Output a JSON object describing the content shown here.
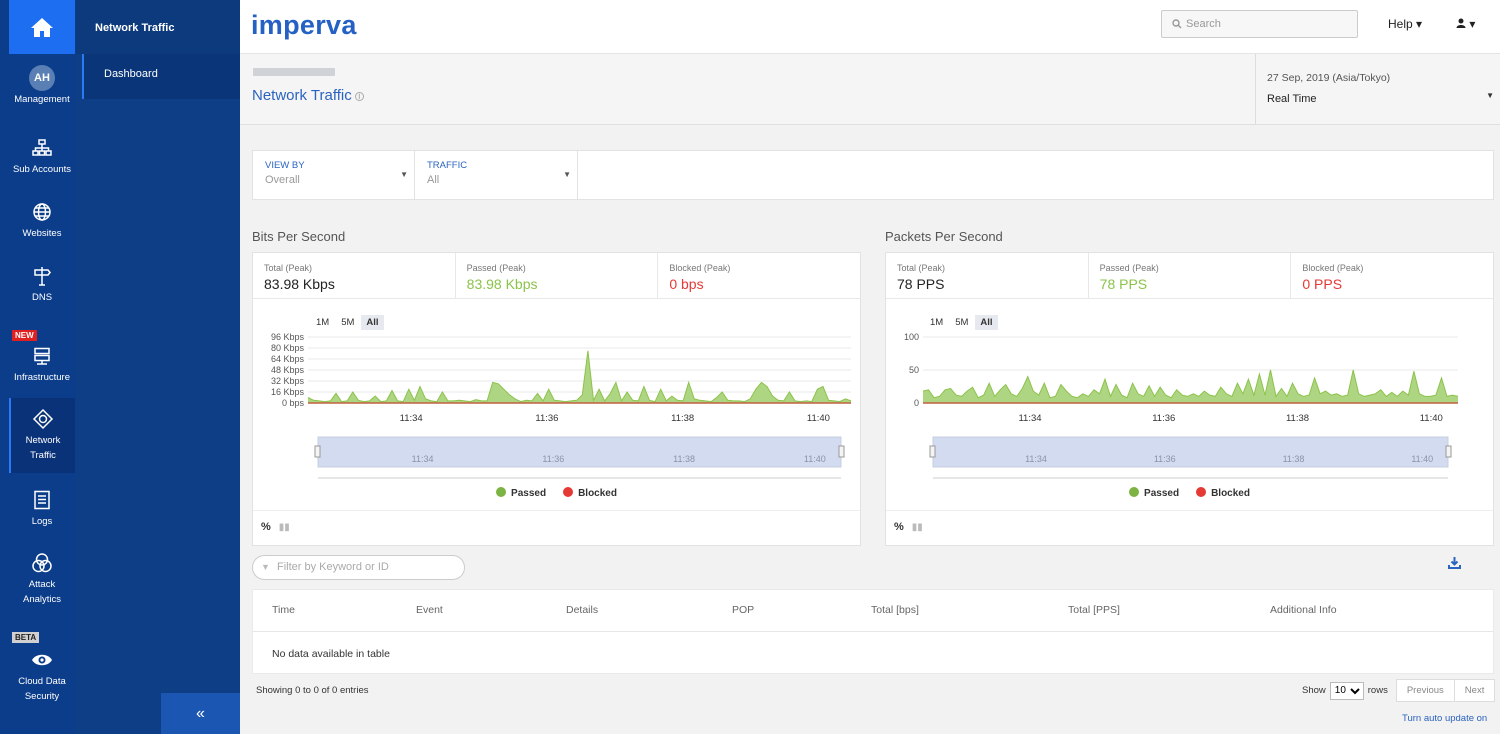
{
  "colors": {
    "brand": "#2561c5",
    "nav_bg": "#0c3d8a",
    "passed": "#8bc34a",
    "blocked": "#e53935",
    "area_fill": "#aed582",
    "navigator": "#d2dbef"
  },
  "nav": {
    "avatar_initials": "AH",
    "items": [
      {
        "label": "Management",
        "icon": "avatar"
      },
      {
        "label": "Sub Accounts",
        "icon": "sitemap-icon"
      },
      {
        "label": "Websites",
        "icon": "globe-icon"
      },
      {
        "label": "DNS",
        "icon": "signpost-icon"
      },
      {
        "label": "Infrastructure",
        "icon": "server-icon",
        "tag": "NEW"
      },
      {
        "label": "Network Traffic",
        "icon": "crosshair-icon",
        "active": true
      },
      {
        "label": "Logs",
        "icon": "logs-icon"
      },
      {
        "label": "Attack Analytics",
        "icon": "analytics-icon"
      },
      {
        "label": "Cloud Data Security",
        "icon": "eye-icon",
        "tag": "BETA"
      }
    ]
  },
  "subnav": {
    "title": "Network Traffic",
    "items": [
      "Dashboard"
    ],
    "collapse": "«"
  },
  "header": {
    "logo": "imperva",
    "search_placeholder": "Search",
    "help": "Help ▾",
    "user": "▾"
  },
  "page": {
    "title": "Network Traffic",
    "date": "27 Sep, 2019 (Asia/Tokyo)",
    "mode": "Real Time"
  },
  "filters": [
    {
      "label": "VIEW BY",
      "value": "Overall"
    },
    {
      "label": "TRAFFIC",
      "value": "All"
    }
  ],
  "bps": {
    "title": "Bits Per Second",
    "stats": [
      {
        "label": "Total (Peak)",
        "value": "83.98 Kbps"
      },
      {
        "label": "Passed (Peak)",
        "value": "83.98 Kbps"
      },
      {
        "label": "Blocked (Peak)",
        "value": "0 bps"
      }
    ]
  },
  "pps": {
    "title": "Packets Per Second",
    "stats": [
      {
        "label": "Total (Peak)",
        "value": "78 PPS"
      },
      {
        "label": "Passed (Peak)",
        "value": "78 PPS"
      },
      {
        "label": "Blocked (Peak)",
        "value": "0 PPS"
      }
    ]
  },
  "zoom": [
    "1M",
    "5M",
    "All"
  ],
  "legend": [
    "Passed",
    "Blocked"
  ],
  "chart_foot": "%",
  "chart_data": [
    {
      "type": "area",
      "title": "Bits Per Second",
      "yticks": [
        "96 Kbps",
        "80 Kbps",
        "64 Kbps",
        "48 Kbps",
        "32 Kbps",
        "16 Kbps",
        "0 bps"
      ],
      "ylim": [
        0,
        96
      ],
      "xticks": [
        "11:34",
        "11:36",
        "11:38",
        "11:40"
      ],
      "series": [
        {
          "name": "Passed",
          "values": [
            8,
            4,
            3,
            2,
            3,
            14,
            2,
            3,
            16,
            4,
            2,
            3,
            10,
            2,
            3,
            18,
            3,
            2,
            20,
            4,
            24,
            6,
            3,
            2,
            16,
            3,
            3,
            4,
            3,
            2,
            5,
            3,
            3,
            30,
            28,
            20,
            12,
            6,
            2,
            4,
            3,
            14,
            3,
            20,
            4,
            3,
            2,
            3,
            4,
            12,
            76,
            4,
            20,
            3,
            14,
            30,
            3,
            16,
            4,
            3,
            24,
            4,
            2,
            20,
            3,
            10,
            4,
            3,
            30,
            6,
            4,
            3,
            2,
            8,
            16,
            4,
            3,
            3,
            2,
            6,
            20,
            30,
            24,
            10,
            4,
            3,
            16,
            3,
            2,
            3,
            2,
            20,
            24,
            4,
            3,
            2,
            6,
            3
          ]
        },
        {
          "name": "Blocked",
          "values": [
            0,
            0,
            0,
            0,
            0,
            0,
            0,
            0,
            0,
            0,
            0,
            0,
            0,
            0,
            0,
            0,
            0,
            0,
            0,
            0,
            0,
            0,
            0,
            0,
            0,
            0,
            0,
            0,
            0,
            0,
            0,
            0,
            0,
            0,
            0,
            0,
            0,
            0,
            0,
            0,
            0,
            0,
            0,
            0,
            0,
            0,
            0,
            0,
            0,
            0,
            0,
            0,
            0,
            0,
            0,
            0,
            0,
            0,
            0,
            0,
            0,
            0,
            0,
            0,
            0,
            0,
            0,
            0,
            0,
            0,
            0,
            0,
            0,
            0,
            0,
            0,
            0,
            0,
            0,
            0,
            0,
            0,
            0,
            0,
            0,
            0,
            0,
            0,
            0,
            0,
            0,
            0,
            0,
            0,
            0,
            0,
            0,
            0,
            0
          ]
        }
      ]
    },
    {
      "type": "area",
      "title": "Packets Per Second",
      "yticks": [
        "100",
        "50",
        "0"
      ],
      "ylim": [
        0,
        100
      ],
      "xticks": [
        "11:34",
        "11:36",
        "11:38",
        "11:40"
      ],
      "series": [
        {
          "name": "Passed",
          "values": [
            18,
            20,
            8,
            10,
            20,
            22,
            12,
            10,
            18,
            24,
            8,
            12,
            30,
            10,
            20,
            28,
            14,
            10,
            22,
            40,
            18,
            12,
            30,
            8,
            10,
            28,
            18,
            10,
            8,
            14,
            10,
            20,
            14,
            36,
            10,
            28,
            12,
            8,
            30,
            14,
            10,
            26,
            10,
            24,
            12,
            8,
            20,
            12,
            10,
            14,
            10,
            18,
            12,
            10,
            24,
            14,
            10,
            30,
            14,
            36,
            12,
            44,
            12,
            50,
            10,
            22,
            10,
            30,
            14,
            10,
            12,
            38,
            14,
            18,
            12,
            14,
            10,
            12,
            50,
            14,
            10,
            12,
            14,
            20,
            10,
            16,
            10,
            18,
            12,
            48,
            14,
            10,
            10,
            12,
            38,
            10,
            12,
            10
          ]
        },
        {
          "name": "Blocked",
          "values": [
            0,
            0,
            0,
            0,
            0,
            0,
            0,
            0,
            0,
            0,
            0,
            0,
            0,
            0,
            0,
            0,
            0,
            0,
            0,
            0,
            0,
            0,
            0,
            0,
            0,
            0,
            0,
            0,
            0,
            0,
            0,
            0,
            0,
            0,
            0,
            0,
            0,
            0,
            0,
            0,
            0,
            0,
            0,
            0,
            0,
            0,
            0,
            0,
            0,
            0,
            0,
            0,
            0,
            0,
            0,
            0,
            0,
            0,
            0,
            0,
            0,
            0,
            0,
            0,
            0,
            0,
            0,
            0,
            0,
            0,
            0,
            0,
            0,
            0,
            0,
            0,
            0,
            0,
            0,
            0,
            0,
            0,
            0,
            0,
            0,
            0,
            0,
            0,
            0,
            0,
            0,
            0,
            0,
            0,
            0,
            0,
            0,
            0,
            0
          ]
        }
      ]
    }
  ],
  "table": {
    "filter_placeholder": "Filter by Keyword or ID",
    "columns": [
      "Time",
      "Event",
      "Details",
      "POP",
      "Total [bps]",
      "Total [PPS]",
      "Additional Info"
    ],
    "empty": "No data available in table",
    "showing": "Showing 0 to 0 of 0 entries",
    "show_label": "Show",
    "rows_value": "10",
    "rows_label": "rows",
    "prev": "Previous",
    "next": "Next",
    "auto_update": "Turn auto update on"
  }
}
